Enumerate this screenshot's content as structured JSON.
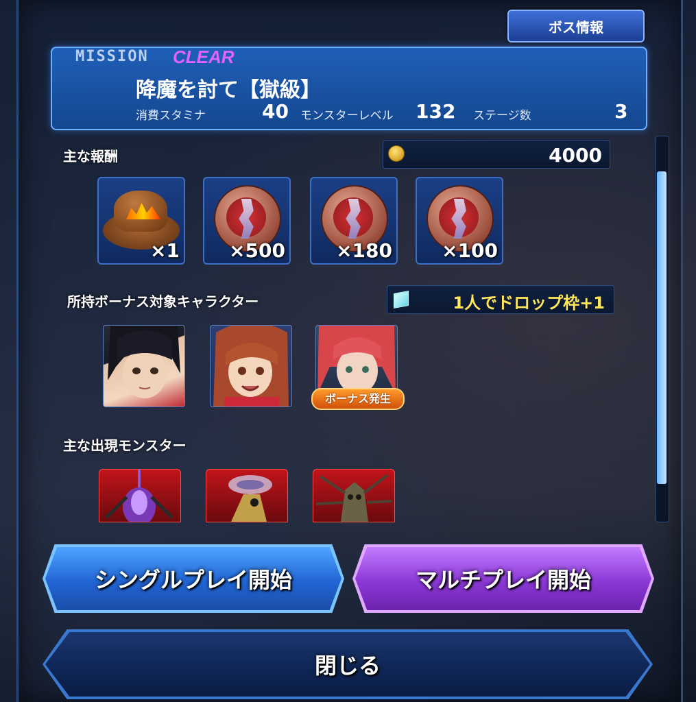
{
  "header": {
    "boss_info_button": "ボス情報"
  },
  "mission": {
    "tag": "MISSION",
    "status": "CLEAR",
    "title": "降魔を討て【獄級】",
    "stamina_label": "消費スタミナ",
    "stamina_value": "40",
    "monster_level_label": "モンスターレベル",
    "monster_level_value": "132",
    "stage_label": "ステージ数",
    "stage_value": "3"
  },
  "rewards": {
    "header": "主な報酬",
    "coin_value": "4000",
    "items": [
      {
        "icon": "hat-icon",
        "qty": "×1"
      },
      {
        "icon": "medal-icon",
        "qty": "×500"
      },
      {
        "icon": "medal-icon",
        "qty": "×180"
      },
      {
        "icon": "medal-icon",
        "qty": "×100"
      }
    ]
  },
  "bonus": {
    "header": "所持ボーナス対象キャラクター",
    "effect": "1人でドロップ枠+1",
    "badge": "ボーナス発生",
    "characters": [
      "character-portrait-1",
      "character-portrait-2",
      "character-portrait-3"
    ]
  },
  "monsters": {
    "header": "主な出現モンスター",
    "list": [
      "monster-1",
      "monster-2",
      "monster-3"
    ]
  },
  "buttons": {
    "single_play": "シングルプレイ開始",
    "multi_play": "マルチプレイ開始",
    "close": "閉じる"
  },
  "colors": {
    "mission_panel": "#1f5fb8",
    "clear_text": "#e063ff",
    "single_button": "#2165d4",
    "multi_button": "#8a38d6",
    "bonus_text": "#ffe65a"
  }
}
